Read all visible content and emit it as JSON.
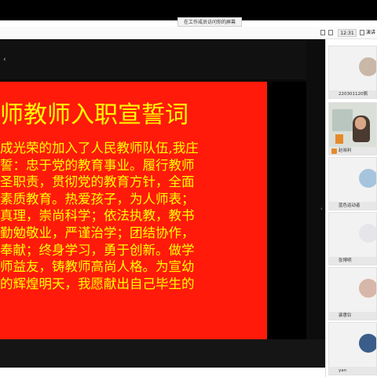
{
  "window": {
    "title": "在工作成员访问你的屏幕"
  },
  "toolbar": {
    "time": "12:31",
    "ctrl_label": "演讲"
  },
  "slide": {
    "title": "师教师入职宣誓词",
    "lines": [
      "成光荣的加入了人民教师队伍,我庄",
      "誓：忠于党的教育事业。履行教师",
      "圣职责，贯彻党的教育方针，全面",
      "素质教育。热爱孩子，为人师表；",
      "真理，崇尚科学；依法执教，教书",
      "勤勉敬业，严谨治学；团结协作，",
      "奉献；终身学习，勇于创新。做学",
      "师益友，铸教师高尚人格。为宣幼",
      "的辉煌明天，我愿献出自己毕生的"
    ],
    "colors": {
      "background": "#ff1a0a",
      "text": "#ffff00"
    }
  },
  "participants": [
    {
      "name": "220301120佩",
      "kind": "avatar",
      "avatar_color": "#c9b8a8"
    },
    {
      "name": "赵晓利",
      "kind": "video"
    },
    {
      "name": "蓝色运动者",
      "kind": "avatar",
      "avatar_color": "#a7c4dd"
    },
    {
      "name": "张博明",
      "kind": "avatar",
      "avatar_color": "#e6e6ea"
    },
    {
      "name": "裴惠铃",
      "kind": "avatar",
      "avatar_color": "#d7b7a9"
    },
    {
      "name": "yan",
      "kind": "avatar",
      "avatar_color": "#3b5d8a"
    }
  ]
}
